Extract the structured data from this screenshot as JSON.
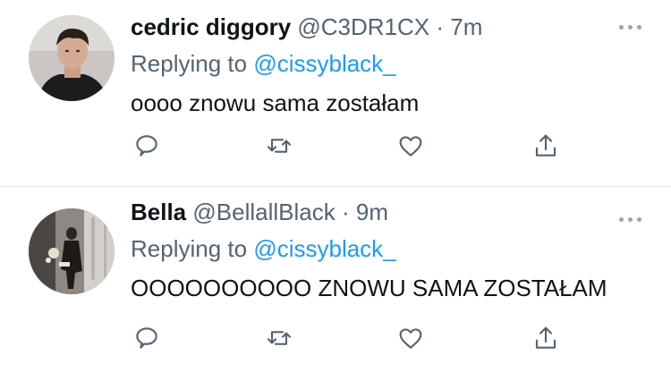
{
  "tweets": [
    {
      "display_name": "cedric diggory",
      "handle": "@C3DR1CX",
      "separator": "·",
      "time": "7m",
      "replying_prefix": "Replying to",
      "replying_mention": "@cissyblack_",
      "text": "oooo znowu sama zostałam"
    },
    {
      "display_name": "Bella",
      "handle": "@BellallBlack",
      "separator": "·",
      "time": "9m",
      "replying_prefix": "Replying to",
      "replying_mention": "@cissyblack_",
      "text": "OOOOOOOOOO ZNOWU SAMA ZOSTAŁAM"
    }
  ],
  "icons": [
    "more-icon",
    "reply-icon",
    "retweet-icon",
    "like-icon",
    "share-icon"
  ],
  "colors": {
    "text_primary": "#0f1419",
    "text_secondary": "#536471",
    "link": "#1d9bf0",
    "divider": "#e6e9ec"
  }
}
